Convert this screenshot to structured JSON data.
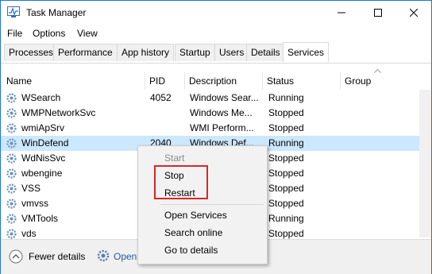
{
  "window": {
    "title": "Task Manager",
    "accent": "#1e78d4"
  },
  "menu": [
    "File",
    "Options",
    "View"
  ],
  "tabs": [
    "Processes",
    "Performance",
    "App history",
    "Startup",
    "Users",
    "Details",
    "Services"
  ],
  "active_tab": "Services",
  "columns": [
    "Name",
    "PID",
    "Description",
    "Status",
    "Group"
  ],
  "rows": [
    {
      "name": "WSearch",
      "pid": "4052",
      "description": "Windows Sear...",
      "status": "Running"
    },
    {
      "name": "WMPNetworkSvc",
      "pid": "",
      "description": "Windows Me...",
      "status": "Stopped"
    },
    {
      "name": "wmiApSrv",
      "pid": "",
      "description": "WMI Perform...",
      "status": "Stopped"
    },
    {
      "name": "WinDefend",
      "pid": "2040",
      "description": "Windows Def...",
      "status": "Running"
    },
    {
      "name": "WdNisSvc",
      "pid": "",
      "description": "",
      "status": "Stopped"
    },
    {
      "name": "wbengine",
      "pid": "",
      "description": "",
      "status": "Stopped"
    },
    {
      "name": "VSS",
      "pid": "",
      "description": "",
      "status": "Stopped"
    },
    {
      "name": "vmvss",
      "pid": "",
      "description": "",
      "status": "Stopped"
    },
    {
      "name": "VMTools",
      "pid": "",
      "description": "",
      "status": "Running"
    },
    {
      "name": "vds",
      "pid": "",
      "description": "",
      "status": "Stopped"
    }
  ],
  "selected_row": "WinDefend",
  "context_menu": {
    "start": "Start",
    "stop": "Stop",
    "restart": "Restart",
    "open_services": "Open Services",
    "search_online": "Search online",
    "go_to_details": "Go to details"
  },
  "footer": {
    "fewer_details": "Fewer details",
    "open_services": "Open Services"
  },
  "colors": {
    "selection": "#cce8ff",
    "highlight_box": "#d9262c",
    "link": "#1e5aa8"
  }
}
